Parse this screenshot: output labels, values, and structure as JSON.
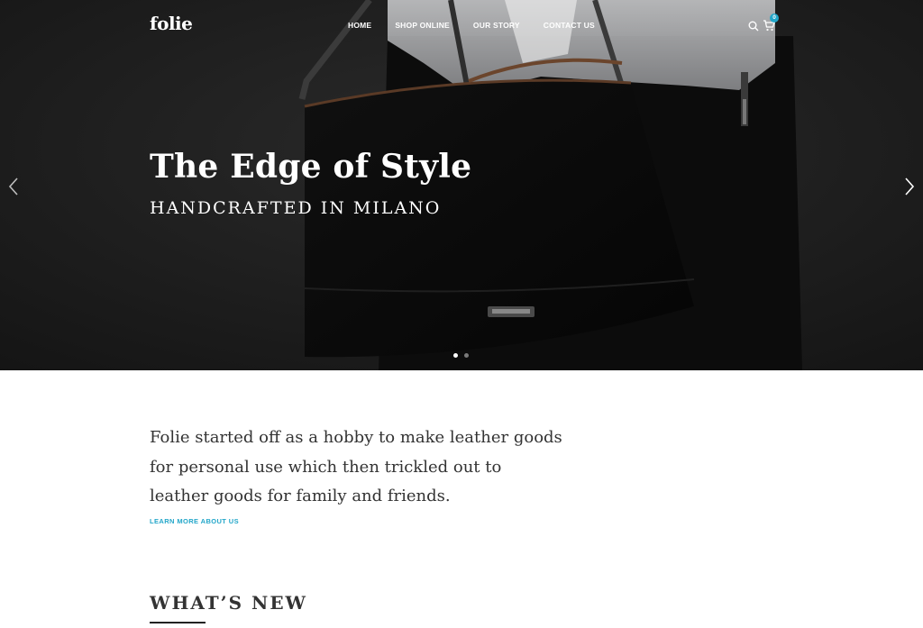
{
  "brand": {
    "logo": "folie"
  },
  "nav": {
    "items": [
      {
        "label": "HOME"
      },
      {
        "label": "SHOP ONLINE"
      },
      {
        "label": "OUR STORY"
      },
      {
        "label": "CONTACT US"
      }
    ]
  },
  "header_icons": {
    "search": "search-icon",
    "cart": "cart-icon",
    "cart_count": "0",
    "accent_color": "#22a6c9"
  },
  "hero": {
    "title": "The Edge of Style",
    "subtitle": "HANDCRAFTED IN MILANO",
    "prev_icon": "chevron-left-icon",
    "next_icon": "chevron-right-icon",
    "slide_count": 2,
    "active_slide": 1
  },
  "intro": {
    "text": "Folie started off as a hobby to make leather goods for personal use which then trickled out to leather goods for family and friends.",
    "link": "LEARN MORE ABOUT US"
  },
  "section": {
    "title": "WHAT’S NEW"
  }
}
